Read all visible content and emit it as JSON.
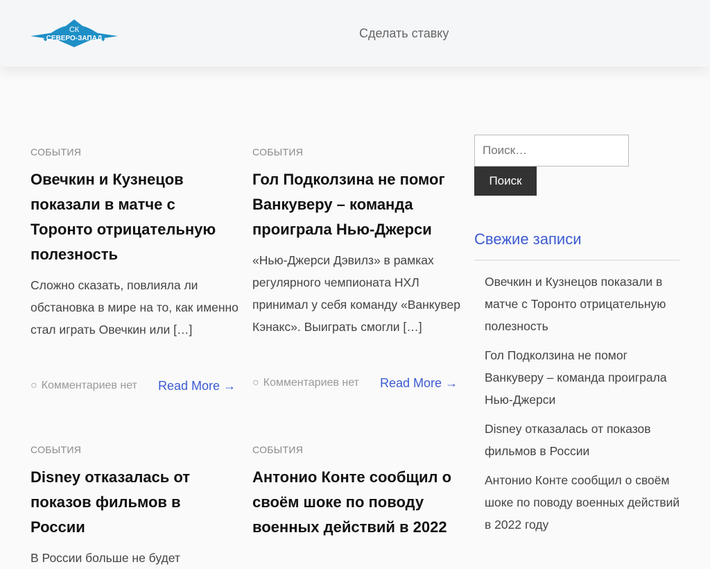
{
  "header": {
    "logo_text": [
      "СК",
      "СЕВЕРО-ЗАПАД"
    ],
    "nav_item": "Сделать ставку"
  },
  "posts": [
    {
      "category": "СОБЫТИЯ",
      "title": "Овечкин и Кузнецов показали в матче с Торонто отрицательную полезность",
      "excerpt": "Сложно сказать, повлияла ли обстановка в мире на то, как именно стал играть Овечкин или […]",
      "comments": "Комментариев нет",
      "read_more": "Read More →"
    },
    {
      "category": "СОБЫТИЯ",
      "title": "Гол Подколзина не помог Ванкуверу – команда проиграла Нью-Джерси",
      "excerpt": "«Нью-Джерси Дэвилз» в рамках регулярного чемпионата НХЛ принимал у себя команду «Ванкувер Кэнакс». Выиграть смогли […]",
      "comments": "Комментариев нет",
      "read_more": "Read More →"
    },
    {
      "category": "СОБЫТИЯ",
      "title": "Disney отказалась от показов фильмов в России",
      "excerpt": "В России больше не будет"
    },
    {
      "category": "СОБЫТИЯ",
      "title": "Антонио Конте сообщил о своём шоке по поводу военных действий в 2022"
    }
  ],
  "sidebar": {
    "search_placeholder": "Поиск…",
    "search_button": "Поиск",
    "recent_title": "Свежие записи",
    "recent": [
      "Овечкин и Кузнецов показали в матче с Торонто отрицательную полезность",
      "Гол Подколзина не помог Ванкуверу – команда проиграла Нью-Джерси",
      "Disney отказалась от показов фильмов в России",
      "Антонио Конте сообщил о своём шоке по поводу военных действий в 2022 году"
    ]
  },
  "colors": {
    "accent": "#3c5bd0",
    "logo": "#1e8fc6"
  }
}
